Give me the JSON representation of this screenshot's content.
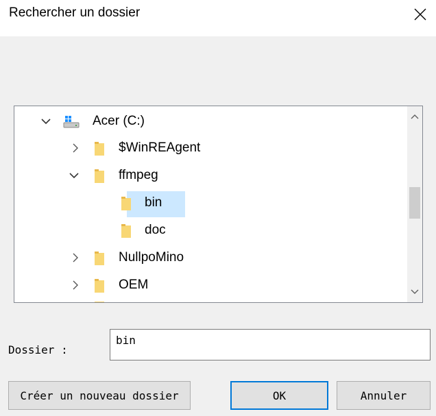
{
  "window": {
    "title": "Rechercher un dossier",
    "close_icon": "close-icon"
  },
  "tree": {
    "items": [
      {
        "label": "Acer (C:)",
        "icon": "drive-icon",
        "expander": "expanded"
      },
      {
        "label": "$WinREAgent",
        "icon": "folder-icon",
        "expander": "collapsed"
      },
      {
        "label": "ffmpeg",
        "icon": "folder-icon",
        "expander": "expanded"
      },
      {
        "label": "bin",
        "icon": "folder-icon",
        "expander": "none",
        "selected": true
      },
      {
        "label": "doc",
        "icon": "folder-icon",
        "expander": "none"
      },
      {
        "label": "NullpoMino",
        "icon": "folder-icon",
        "expander": "collapsed"
      },
      {
        "label": "OEM",
        "icon": "folder-icon",
        "expander": "collapsed"
      }
    ]
  },
  "folder_field": {
    "label": "Dossier :",
    "value": "bin"
  },
  "buttons": {
    "create": "Créer un nouveau dossier",
    "ok": "OK",
    "cancel": "Annuler"
  },
  "colors": {
    "selection": "#cce8ff",
    "folder": "#f8d775",
    "default_button_border": "#0078d7"
  }
}
